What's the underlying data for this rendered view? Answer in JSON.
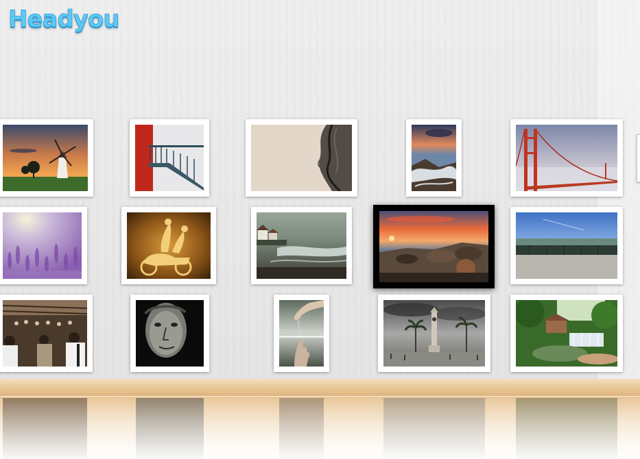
{
  "app": {
    "logo_text": "Headyou"
  },
  "gallery": {
    "rows": [
      {
        "name": "row-1",
        "photos": [
          {
            "name": "photo-windmill-sunset",
            "theme": "windmill"
          },
          {
            "name": "photo-red-balcony-stairs",
            "theme": "balcony"
          },
          {
            "name": "photo-curly-hair-profile",
            "theme": "hair"
          },
          {
            "name": "photo-seascape-waves",
            "theme": "waves"
          },
          {
            "name": "photo-golden-gate-bridge",
            "theme": "bridge"
          }
        ]
      },
      {
        "name": "row-2",
        "photos": [
          {
            "name": "photo-lavender-field",
            "theme": "lavender"
          },
          {
            "name": "photo-scooter-silhouette",
            "theme": "scooter"
          },
          {
            "name": "photo-coastal-village",
            "theme": "coast"
          },
          {
            "name": "photo-rocky-beach-sunset",
            "theme": "rocks",
            "selected": true
          },
          {
            "name": "photo-warehouse-sky",
            "theme": "warehouse"
          }
        ]
      },
      {
        "name": "row-3",
        "photos": [
          {
            "name": "photo-market-crowd",
            "theme": "crowd"
          },
          {
            "name": "photo-man-portrait",
            "theme": "portrait"
          },
          {
            "name": "photo-hands-water",
            "theme": "hands"
          },
          {
            "name": "photo-clock-tower-palms",
            "theme": "tower"
          },
          {
            "name": "photo-garden-waterfall",
            "theme": "garden"
          }
        ]
      }
    ]
  },
  "colors": {
    "logo": "#5ec8f5",
    "frame": "#ffffff",
    "selected_frame": "#000000",
    "shelf": "#e9c99a"
  }
}
